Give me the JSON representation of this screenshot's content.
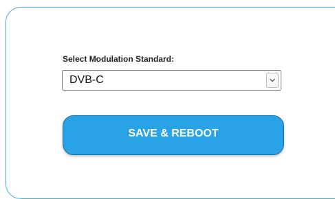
{
  "form": {
    "modulation_label": "Select Modulation Standard:",
    "modulation_selected": "DVB-C",
    "save_button_label": "SAVE & REBOOT"
  },
  "icons": {
    "select_arrow": "chevron-down-icon"
  },
  "colors": {
    "panel_border": "#4aa6dd",
    "button_fill": "#2aa3e6",
    "button_border": "#1c6fa3",
    "button_text": "#ffffff"
  }
}
